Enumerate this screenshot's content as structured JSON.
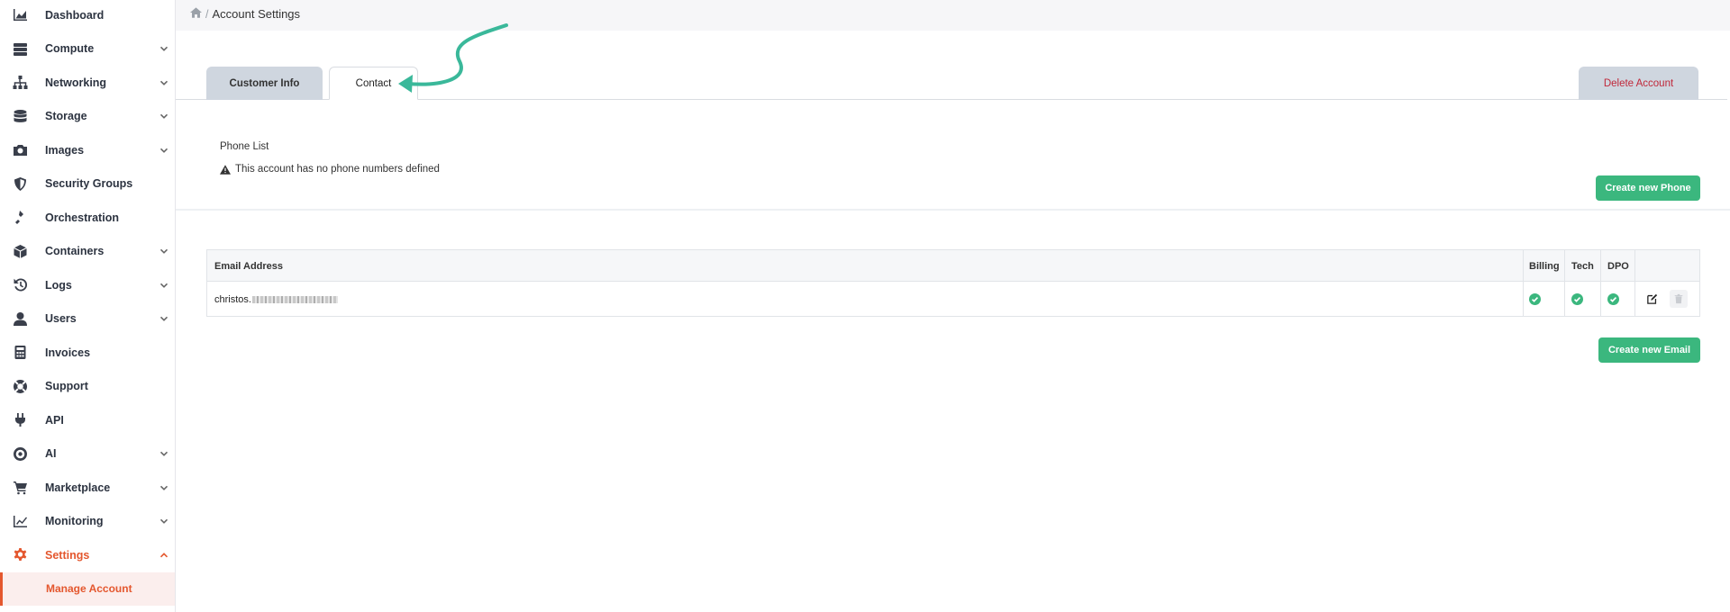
{
  "sidebar": {
    "items": [
      {
        "label": "Dashboard",
        "icon": "chart-area-icon",
        "chevron": false
      },
      {
        "label": "Compute",
        "icon": "server-icon",
        "chevron": true
      },
      {
        "label": "Networking",
        "icon": "network-icon",
        "chevron": true
      },
      {
        "label": "Storage",
        "icon": "database-icon",
        "chevron": true
      },
      {
        "label": "Images",
        "icon": "camera-icon",
        "chevron": true
      },
      {
        "label": "Security Groups",
        "icon": "shield-icon",
        "chevron": false
      },
      {
        "label": "Orchestration",
        "icon": "orchestration-icon",
        "chevron": false
      },
      {
        "label": "Containers",
        "icon": "cube-icon",
        "chevron": true
      },
      {
        "label": "Logs",
        "icon": "history-icon",
        "chevron": true
      },
      {
        "label": "Users",
        "icon": "user-icon",
        "chevron": true
      },
      {
        "label": "Invoices",
        "icon": "calculator-icon",
        "chevron": false
      },
      {
        "label": "Support",
        "icon": "lifebuoy-icon",
        "chevron": false
      },
      {
        "label": "API",
        "icon": "plug-icon",
        "chevron": false
      },
      {
        "label": "AI",
        "icon": "ai-icon",
        "chevron": true
      },
      {
        "label": "Marketplace",
        "icon": "cart-icon",
        "chevron": true
      },
      {
        "label": "Monitoring",
        "icon": "line-chart-icon",
        "chevron": true
      },
      {
        "label": "Settings",
        "icon": "gear-icon",
        "chevron": true,
        "expanded": true
      }
    ],
    "sub_item": {
      "label": "Manage Account"
    }
  },
  "breadcrumb": {
    "separator": "/",
    "current": "Account Settings"
  },
  "tabs": {
    "customer_info": "Customer Info",
    "contact": "Contact",
    "delete": "Delete Account"
  },
  "phone": {
    "title": "Phone List",
    "empty_message": "This account has no phone numbers defined",
    "create_button": "Create new Phone"
  },
  "email_table": {
    "headers": {
      "email": "Email Address",
      "billing": "Billing",
      "tech": "Tech",
      "dpo": "DPO"
    },
    "rows": [
      {
        "email_prefix": "christos.",
        "billing": true,
        "tech": true,
        "dpo": true
      }
    ],
    "create_button": "Create new Email"
  },
  "colors": {
    "accent": "#e4572e",
    "green": "#3bb77e",
    "danger": "#c0283a",
    "annotation": "#3ab89a"
  }
}
